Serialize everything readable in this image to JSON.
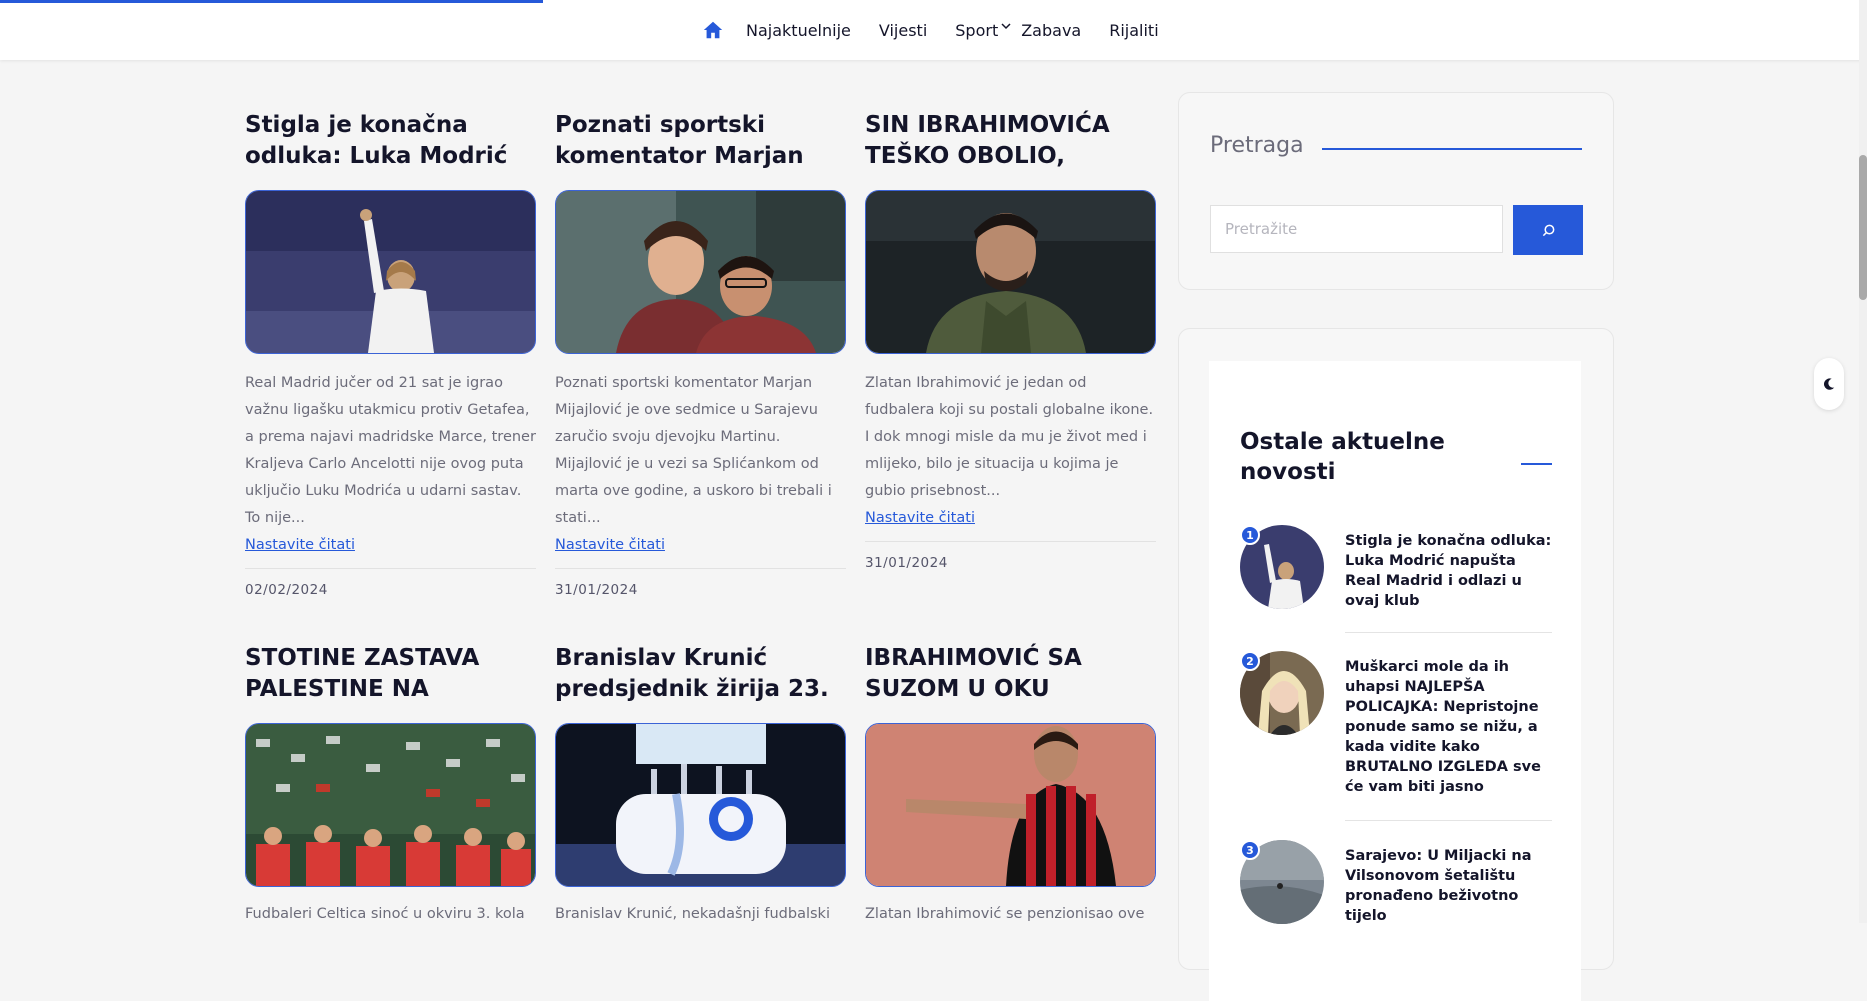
{
  "nav": {
    "items": [
      "Najaktuelnije",
      "Vijesti",
      "Sport",
      "Zabava",
      "Rijaliti"
    ],
    "icons": {
      "home": "home-icon",
      "sport_dropdown": "chevron-down-icon"
    },
    "accent": "#2659d9"
  },
  "articles": [
    {
      "title": "Stigla je konačna odluka: Luka Modrić",
      "excerpt": "Real Madrid jučer od 21 sat je igrao važnu ligašku utakmicu protiv Getafea, a prema najavi madridske Marce, trener Kraljeva Carlo Ancelotti nije ovog puta uključio Luku Modrića u udarni sastav. To nije...",
      "more": "Nastavite čitati",
      "date": "02/02/2024"
    },
    {
      "title": "Poznati sportski komentator Marjan",
      "excerpt": "Poznati sportski komentator Marjan Mijajlović je ove sedmice u Sarajevu zaručio svoju djevojku Martinu. Mijajlović je u vezi sa Splićankom od marta ove godine, a uskoro bi trebali i stati...",
      "more": "Nastavite čitati",
      "date": "31/01/2024"
    },
    {
      "title": "SIN IBRAHIMOVIĆA TEŠKO OBOLIO,",
      "excerpt": "Zlatan Ibrahimović je jedan od fudbalera koji su postali globalne ikone. I dok mnogi misle da mu je život med i mlijeko, bilo je situacija u kojima je gubio prisebnost...",
      "more": "Nastavite čitati",
      "date": "31/01/2024"
    },
    {
      "title": "STOTINE ZASTAVA PALESTINE NA",
      "excerpt": "Fudbaleri Celtica sinoć u okviru 3. kola"
    },
    {
      "title": "Branislav Krunić predsjednik žirija 23.",
      "excerpt": "Branislav Krunić, nekadašnji fudbalski"
    },
    {
      "title": "IBRAHIMOVIĆ SA SUZOM U OKU",
      "excerpt": "Zlatan Ibrahimović se penzionisao ove"
    }
  ],
  "sidebar": {
    "search": {
      "title": "Pretraga",
      "placeholder": "Pretražite",
      "button_icon": "search-icon"
    },
    "news": {
      "title": "Ostale aktuelne novosti",
      "items": [
        {
          "num": "1",
          "text": "Stigla je konačna odluka: Luka Modrić napušta Real Madrid i odlazi u ovaj klub"
        },
        {
          "num": "2",
          "text": "Muškarci mole da ih uhapsi NAJLEPŠA POLICAJKA: Nepristojne ponude samo se nižu, a kada vidite kako BRUTALNO IZGLEDA sve će vam biti jasno"
        },
        {
          "num": "3",
          "text": "Sarajevo: U Miljacki na Vilsonovom šetalištu pronađeno beživotno tijelo"
        }
      ]
    }
  },
  "theme_toggle_icon": "moon-icon"
}
